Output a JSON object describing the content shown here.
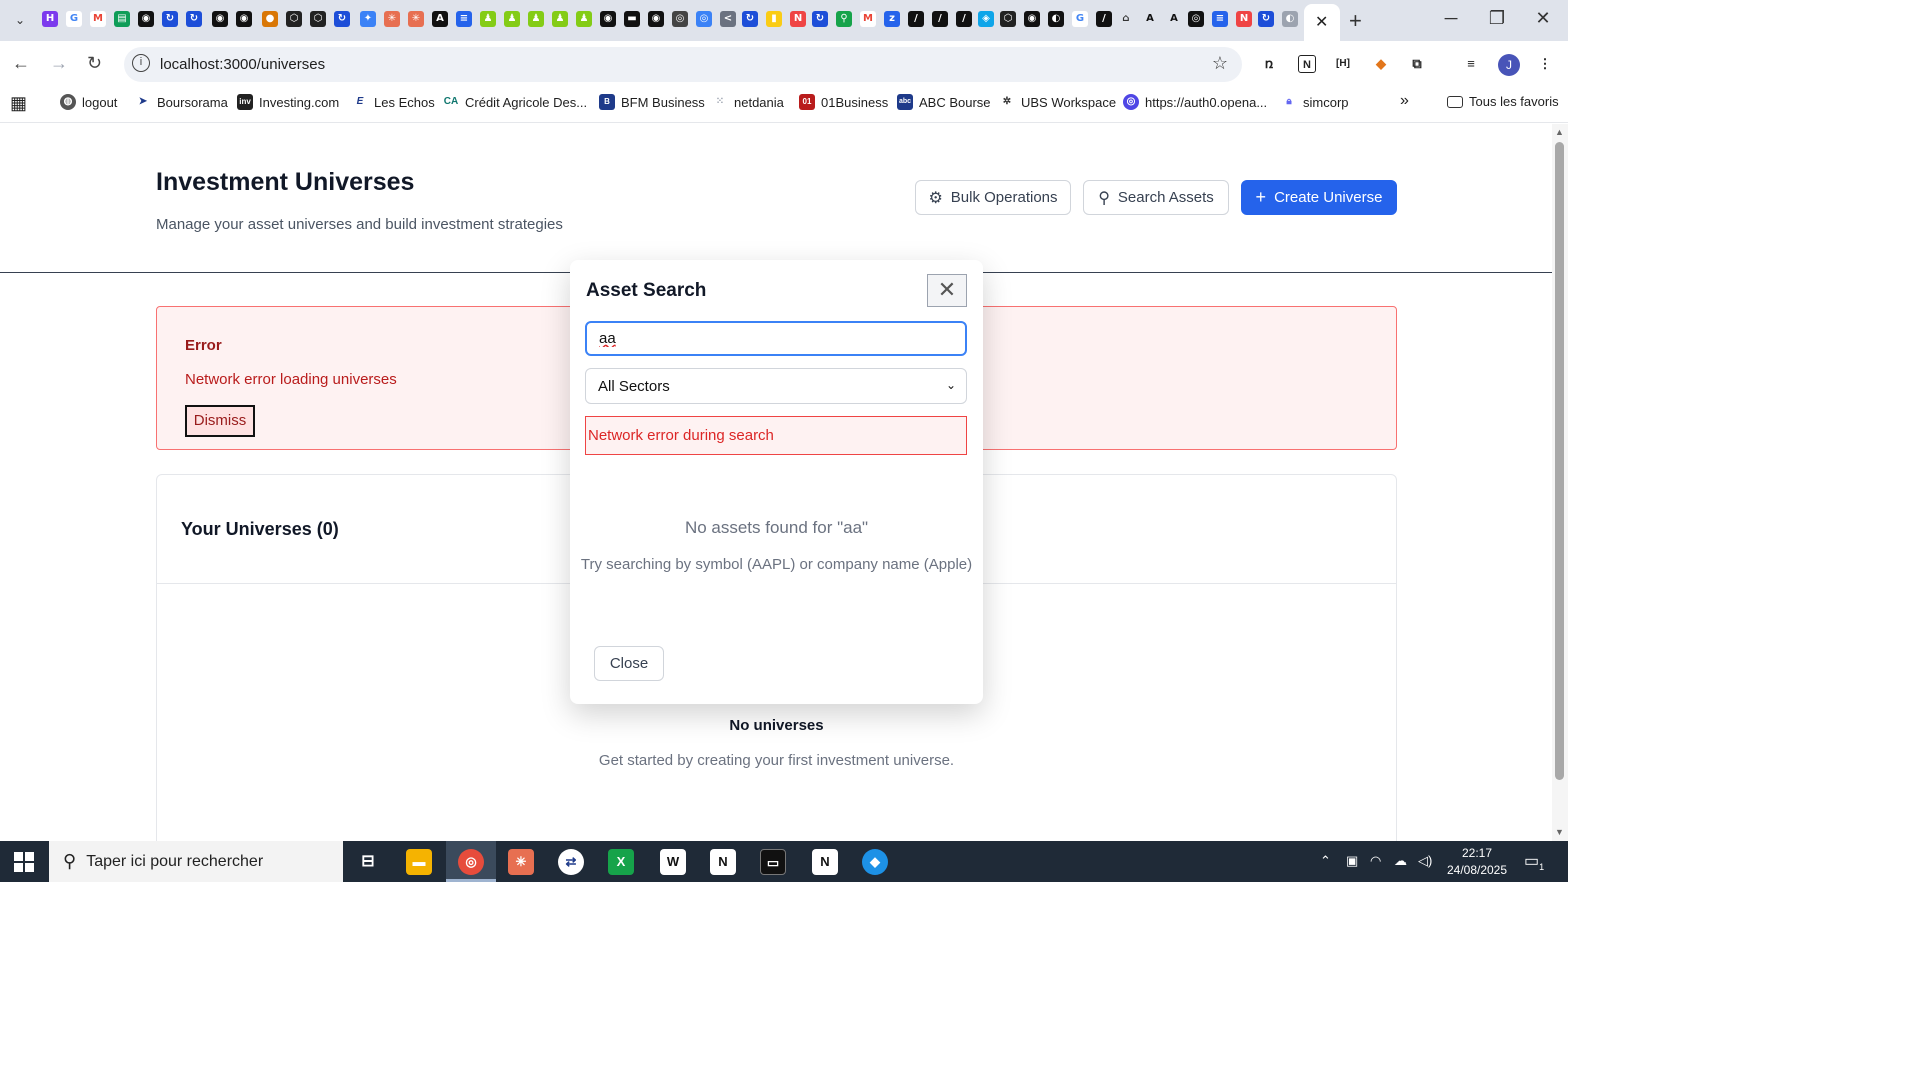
{
  "browser": {
    "active_tab_close": "✕",
    "new_tab": "+",
    "url": "localhost:3000/universes",
    "profile_initial": "J",
    "bookmarks": [
      {
        "label": "logout",
        "icon": "globe-icon",
        "color": "#555555"
      },
      {
        "label": "Boursorama",
        "icon": "arrow-icon",
        "color": "#1e3a8a"
      },
      {
        "label": "Investing.com",
        "icon": "inv-icon",
        "color": "#222222"
      },
      {
        "label": "Les Echos",
        "icon": "e-icon",
        "color": "#1e3a8a"
      },
      {
        "label": "Crédit Agricole Des...",
        "icon": "ca-icon",
        "color": "#0f766e"
      },
      {
        "label": "BFM Business",
        "icon": "bfm-icon",
        "color": "#1e3a8a"
      },
      {
        "label": "netdania",
        "icon": "netdania-icon",
        "color": "#9ca3af"
      },
      {
        "label": "01Business",
        "icon": "01-icon",
        "color": "#b91c1c"
      },
      {
        "label": "ABC Bourse",
        "icon": "abc-icon",
        "color": "#1e3a8a"
      },
      {
        "label": "UBS Workspace",
        "icon": "ubs-icon",
        "color": "#333333"
      },
      {
        "label": "https://auth0.opena...",
        "icon": "openai-icon",
        "color": "#4f46e5"
      },
      {
        "label": "simcorp",
        "icon": "lock-icon",
        "color": "#6366f1"
      }
    ],
    "more_bookmarks": "»",
    "all_favorites": "Tous les favoris"
  },
  "page": {
    "title": "Investment Universes",
    "subtitle": "Manage your asset universes and build investment strategies",
    "buttons": {
      "bulk": "Bulk Operations",
      "search": "Search Assets",
      "create": "Create Universe"
    },
    "error": {
      "title": "Error",
      "message": "Network error loading universes",
      "dismiss": "Dismiss"
    },
    "universes": {
      "title": "Your Universes (0)",
      "empty_title": "No universes",
      "empty_desc": "Get started by creating your first investment universe."
    }
  },
  "modal": {
    "title": "Asset Search",
    "close_x": "✕",
    "search_value": "aa",
    "sector_selected": "All Sectors",
    "error": "Network error during search",
    "no_results": "No assets found for \"aa\"",
    "hint": "Try searching by symbol (AAPL) or company name (Apple)",
    "close": "Close"
  },
  "taskbar": {
    "search_placeholder": "Taper ici pour rechercher",
    "time": "22:17",
    "date": "24/08/2025",
    "notifications": "1"
  },
  "colors": {
    "primary": "#2563eb",
    "error_text": "#b91c1c",
    "error_bg": "#fef2f2",
    "taskbar": "#1f2a37"
  }
}
